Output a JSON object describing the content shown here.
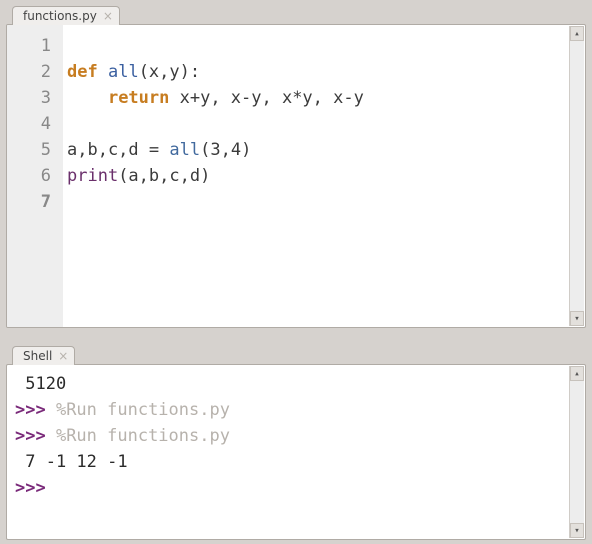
{
  "editor": {
    "tab_label": "functions.py",
    "line_numbers": [
      "1",
      "2",
      "3",
      "4",
      "5",
      "6",
      "7"
    ],
    "code": {
      "l1": "",
      "l2_def": "def",
      "l2_name": "all",
      "l2_params": "(x,y):",
      "l3_return": "return",
      "l3_body": " x+y, x-y, x*y, x-y",
      "l4": "",
      "l5_lhs": "a,b,c,d = ",
      "l5_call": "all",
      "l5_args": "(",
      "l5_arg1": "3",
      "l5_comma": ",",
      "l5_arg2": "4",
      "l5_close": ")",
      "l6_print": "print",
      "l6_args": "(a,b,c,d)",
      "l7": ""
    }
  },
  "shell": {
    "tab_label": "Shell",
    "lines": {
      "out1": " 5120",
      "prompt": ">>> ",
      "run1": "%Run functions.py",
      "run2": "%Run functions.py",
      "out2": " 7 -1 12 -1",
      "blank_prompt": ">>> "
    }
  }
}
